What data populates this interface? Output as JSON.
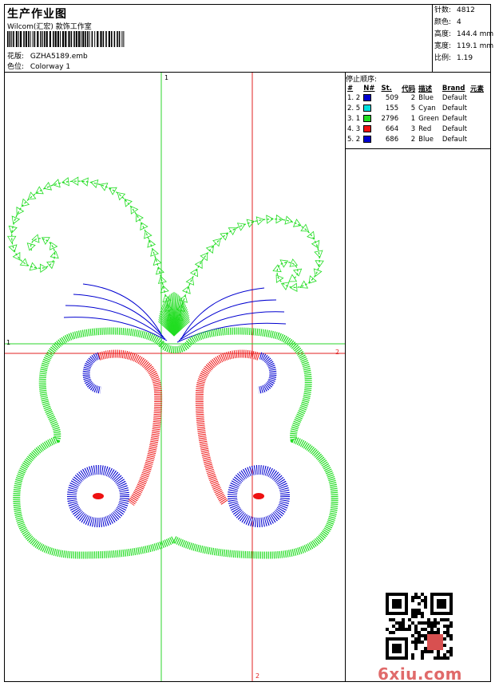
{
  "header": {
    "title": "生产作业图",
    "subtitle": "Wilcom(汇宏) 款饰工作室",
    "design_label": "花版:",
    "design_value": "GZHA5189.emb",
    "color_label": "色位:",
    "color_value": "Colorway 1"
  },
  "stats": [
    {
      "label": "针数:",
      "value": "4812"
    },
    {
      "label": "颜色:",
      "value": "4"
    },
    {
      "label": "高度:",
      "value": "144.4 mm"
    },
    {
      "label": "宽度:",
      "value": "119.1 mm"
    },
    {
      "label": "比例:",
      "value": "1.19"
    }
  ],
  "stop_sequence": {
    "title": "停止顺序:",
    "headers": [
      "#",
      "N#",
      "St.",
      "代码",
      "描述",
      "Brand",
      "元素"
    ],
    "rows": [
      {
        "num": "1. 2",
        "color": "#0000d0",
        "st": "509",
        "code": "2",
        "desc": "Blue",
        "brand": "Default"
      },
      {
        "num": "2. 5",
        "color": "#00e0e0",
        "st": "155",
        "code": "5",
        "desc": "Cyan",
        "brand": "Default"
      },
      {
        "num": "3. 1",
        "color": "#22dd22",
        "st": "2796",
        "code": "1",
        "desc": "Green",
        "brand": "Default"
      },
      {
        "num": "4. 3",
        "color": "#ee1111",
        "st": "664",
        "code": "3",
        "desc": "Red",
        "brand": "Default"
      },
      {
        "num": "5. 2",
        "color": "#0000d0",
        "st": "686",
        "code": "2",
        "desc": "Blue",
        "brand": "Default"
      }
    ]
  },
  "guides": {
    "v1": "1",
    "h1": "1",
    "h2": "2",
    "v2": "2"
  },
  "watermark": "6xiu.com",
  "colors": {
    "green": "#22dd22",
    "red": "#ee1111",
    "blue": "#0000d0",
    "guide_green": "#2bd62b",
    "guide_red": "#e02020"
  }
}
